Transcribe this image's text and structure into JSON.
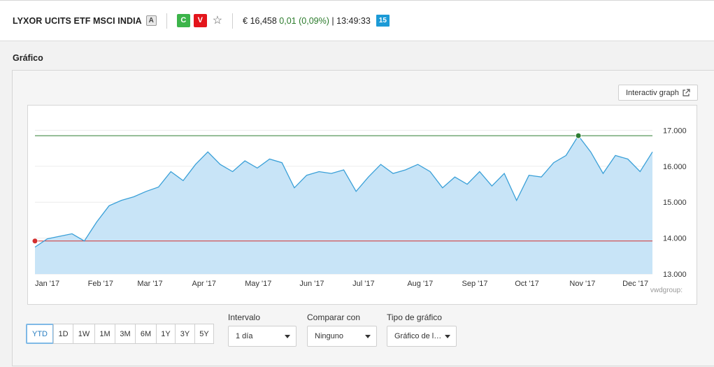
{
  "header": {
    "title": "LYXOR UCITS ETF MSCI INDIA",
    "badge": "A",
    "buy_label": "C",
    "sell_label": "V",
    "price": "€ 16,458",
    "change": "0,01",
    "change_pct": "(0,09%)",
    "time": "| 13:49:33",
    "delay_badge": "15"
  },
  "section": {
    "title": "Gráfico"
  },
  "chart_toolbar": {
    "interactive_label": "Interactiv graph"
  },
  "chart_data": {
    "type": "area",
    "x": [
      "2017-01-02",
      "2017-01-09",
      "2017-01-16",
      "2017-01-23",
      "2017-01-30",
      "2017-02-06",
      "2017-02-13",
      "2017-02-20",
      "2017-02-27",
      "2017-03-06",
      "2017-03-13",
      "2017-03-20",
      "2017-03-27",
      "2017-04-03",
      "2017-04-10",
      "2017-04-17",
      "2017-04-24",
      "2017-05-01",
      "2017-05-08",
      "2017-05-15",
      "2017-05-22",
      "2017-05-29",
      "2017-06-05",
      "2017-06-12",
      "2017-06-19",
      "2017-06-26",
      "2017-07-03",
      "2017-07-10",
      "2017-07-17",
      "2017-07-24",
      "2017-07-31",
      "2017-08-07",
      "2017-08-14",
      "2017-08-21",
      "2017-08-28",
      "2017-09-04",
      "2017-09-11",
      "2017-09-18",
      "2017-09-25",
      "2017-10-02",
      "2017-10-09",
      "2017-10-16",
      "2017-10-23",
      "2017-10-30",
      "2017-11-06",
      "2017-11-13",
      "2017-11-20",
      "2017-11-27",
      "2017-12-04",
      "2017-12-11",
      "2017-12-18"
    ],
    "series": [
      {
        "values": [
          13.75,
          13.98,
          14.05,
          14.12,
          13.92,
          14.45,
          14.9,
          15.05,
          15.15,
          15.3,
          15.42,
          15.85,
          15.6,
          16.05,
          16.4,
          16.05,
          15.85,
          16.15,
          15.95,
          16.2,
          16.1,
          15.4,
          15.75,
          15.85,
          15.8,
          15.9,
          15.3,
          15.7,
          16.05,
          15.8,
          15.9,
          16.05,
          15.85,
          15.4,
          15.7,
          15.5,
          15.85,
          15.45,
          15.8,
          15.05,
          15.75,
          15.7,
          16.1,
          16.3,
          16.85,
          16.4,
          15.8,
          16.3,
          16.2,
          15.85,
          16.4
        ]
      }
    ],
    "reference_lines": [
      {
        "label": "max",
        "value": 16.85,
        "color": "#2e7d32"
      },
      {
        "label": "min",
        "value": 13.92,
        "color": "#d32f2f"
      }
    ],
    "xlabel": "",
    "ylabel": "",
    "x_ticks": [
      "Jan '17",
      "Feb '17",
      "Mar '17",
      "Apr '17",
      "May '17",
      "Jun '17",
      "Jul '17",
      "Aug '17",
      "Sep '17",
      "Oct '17",
      "Nov '17",
      "Dec '17"
    ],
    "y_ticks": [
      "17.000",
      "16.000",
      "15.000",
      "14.000",
      "13.000"
    ],
    "ylim": [
      13,
      17.3
    ],
    "grid": true,
    "line_color": "#3aa0d8",
    "fill_color": "#c8e4f7",
    "source_label": "vwdgroup:"
  },
  "controls": {
    "ranges": [
      "YTD",
      "1D",
      "1W",
      "1M",
      "3M",
      "6M",
      "1Y",
      "3Y",
      "5Y"
    ],
    "active_range": "YTD",
    "interval_label": "Intervalo",
    "interval_value": "1 día",
    "compare_label": "Comparar con",
    "compare_value": "Ninguno",
    "chart_type_label": "Tipo de gráfico",
    "chart_type_value": "Gráfico de l…"
  },
  "colors": {
    "buy": "#3cb44a",
    "sell": "#e3151b",
    "badge": "#1c9ad6",
    "accent": "#2b7fc1"
  },
  "icons": {
    "favorite": "star-icon",
    "external": "external-link-icon",
    "dropdown": "caret-down-icon"
  }
}
